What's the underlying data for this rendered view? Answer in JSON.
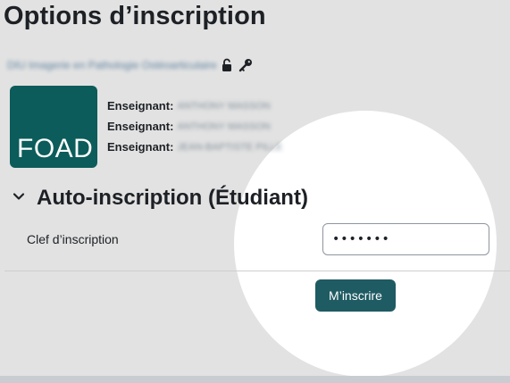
{
  "page": {
    "title": "Options d’inscription"
  },
  "course": {
    "name": "DIU Imagerie en Pathologie Ostéoarticulaire",
    "guest_icon": "unlock-icon",
    "self_enrol_icon": "key-icon",
    "image_text": "FOAD",
    "image_color": "#0b5c5a",
    "teachers": [
      {
        "role": "Enseignant:",
        "name": "ANTHONY MASSON"
      },
      {
        "role": "Enseignant:",
        "name": "ANTHONY MASSON"
      },
      {
        "role": "Enseignant:",
        "name": "JEAN-BAPTISTE PILLE"
      }
    ]
  },
  "enrolment": {
    "section_title": "Auto-inscription (Étudiant)",
    "toggle_icon": "chevron-down-icon",
    "key_label": "Clef d’inscription",
    "key_value": "•••••••",
    "submit_label": "M’inscrire",
    "submit_color": "#1f5b63"
  }
}
